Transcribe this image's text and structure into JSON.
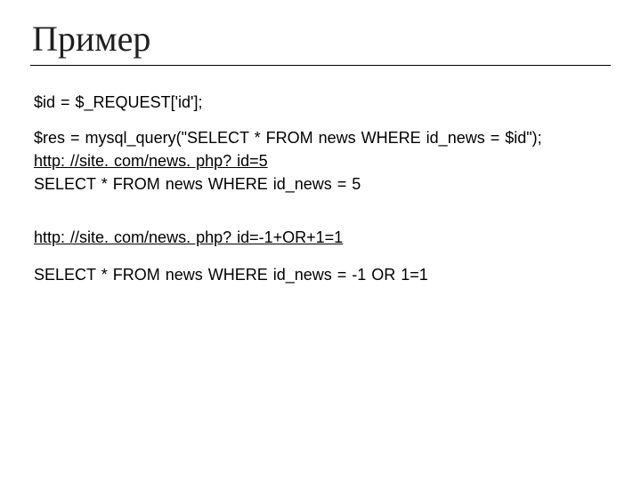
{
  "title": "Пример",
  "lines": {
    "l1": "$id = $_REQUEST['id'];",
    "l2": "$res = mysql_query(\"SELECT * FROM news WHERE id_news = $id\");",
    "l3": "http: //site. com/news. php? id=5",
    "l4": "SELECT * FROM news WHERE id_news = 5",
    "l5": "http: //site. com/news. php? id=-1+OR+1=1",
    "l6": "SELECT * FROM news WHERE id_news = -1 OR 1=1"
  }
}
